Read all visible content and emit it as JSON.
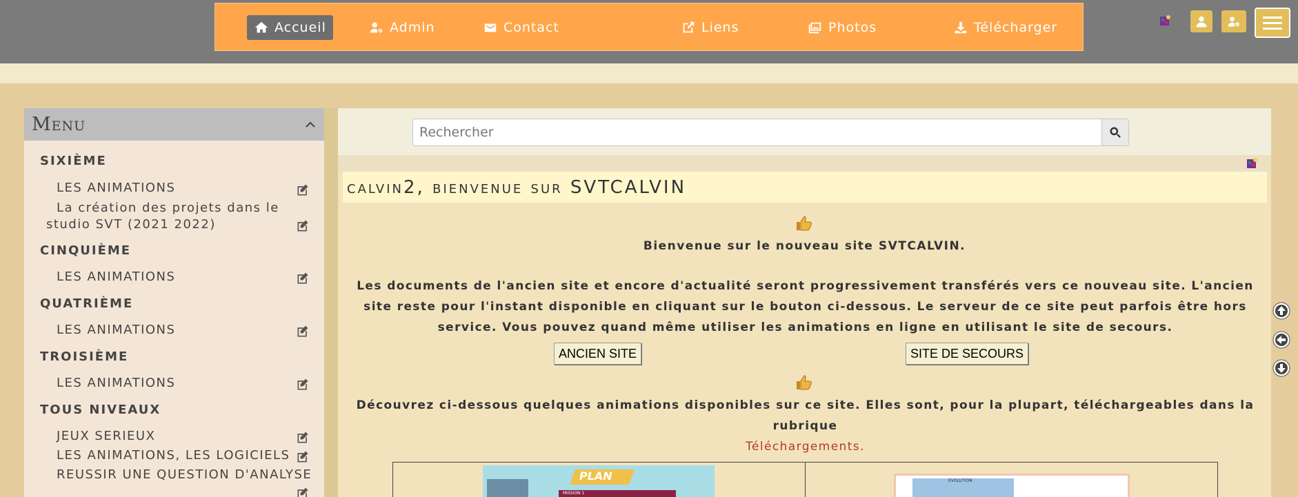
{
  "nav": {
    "items": [
      {
        "label": "Accueil",
        "icon": "home-icon",
        "active": true
      },
      {
        "label": "Admin",
        "icon": "user-gear-icon",
        "active": false
      },
      {
        "label": "Contact",
        "icon": "envelope-icon",
        "active": false
      },
      {
        "label": "Liens",
        "icon": "external-link-icon",
        "active": false
      },
      {
        "label": "Photos",
        "icon": "images-icon",
        "active": false
      },
      {
        "label": "Télécharger",
        "icon": "download-icon",
        "active": false
      }
    ]
  },
  "menu": {
    "title": "Menu",
    "categories": [
      {
        "label": "SIXIÈME",
        "links": [
          "LES ANIMATIONS",
          "La création des projets dans le studio SVT (2021 2022)"
        ]
      },
      {
        "label": "CINQUIÈME",
        "links": [
          "LES ANIMATIONS"
        ]
      },
      {
        "label": "QUATRIÈME",
        "links": [
          "LES ANIMATIONS"
        ]
      },
      {
        "label": "TROISIÈME",
        "links": [
          "LES ANIMATIONS"
        ]
      },
      {
        "label": "TOUS NIVEAUX",
        "links": [
          "JEUX SERIEUX",
          "LES ANIMATIONS, LES LOGICIELS",
          "REUSSIR UNE QUESTION D'ANALYSE"
        ]
      }
    ]
  },
  "search": {
    "placeholder": "Rechercher"
  },
  "content": {
    "title": "calvin2, bienvenue sur SVTCALVIN",
    "welcome_line": "Bienvenue sur le nouveau site SVTCALVIN.",
    "paragraph": "Les documents de l'ancien site et encore d'actualité seront progressivement transférés vers ce nouveau site.  L'ancien site reste pour l'instant disponible en cliquant sur le bouton ci-dessous. Le serveur de ce site peut parfois être hors service. Vous pouvez quand même utiliser les animations en ligne en utilisant le site de secours.",
    "button_old": "ANCIEN SITE",
    "button_backup": "SITE DE SECOURS",
    "discover_text": "Découvrez ci-dessous quelques animations disponibles sur ce site. Elles sont, pour la plupart, téléchargeables dans la rubrique",
    "downloads_link": "Téléchargements.",
    "thumb1_label": "PLAN",
    "thumb1_sub": "MISSION 1",
    "thumb2_label": "EVOLUTION"
  },
  "colors": {
    "nav_bg": "#ffa64a",
    "topbar_bg": "#7b7b7b",
    "accent_btn": "#e2bd5a",
    "link": "#b33a2a"
  }
}
